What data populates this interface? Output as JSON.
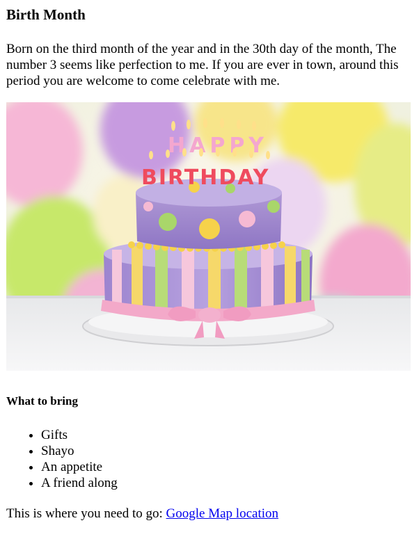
{
  "page": {
    "title": "Birth Month",
    "intro": "Born on the third month of the year and in the 30th day of the month, The number 3 seems like perfection to me. If you are ever in town, around this period you are welcome to come celebrate with me.",
    "image": {
      "cake_text_top": "HAPPY",
      "cake_text_bottom": "BIRTHDAY"
    },
    "section_heading": "What to bring",
    "items": [
      "Gifts",
      "Shayo",
      "An appetite",
      "A friend along"
    ],
    "outro_text": "This is where you need to go: ",
    "link_label": "Google Map location"
  }
}
